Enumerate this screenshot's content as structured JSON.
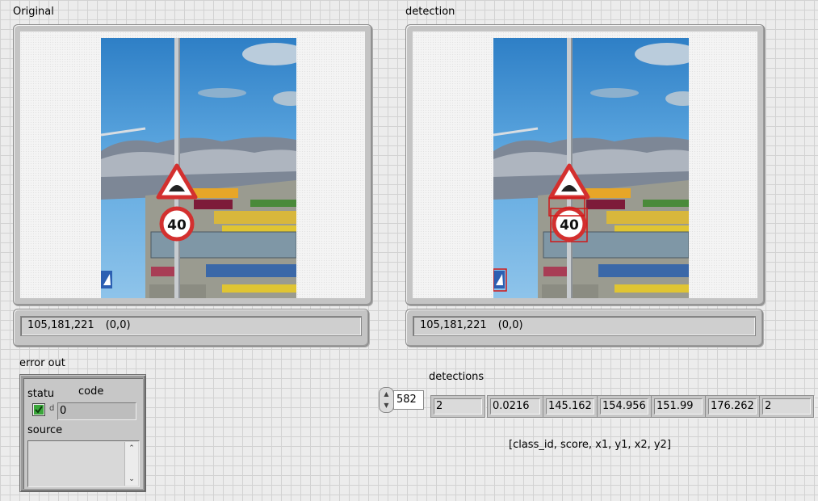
{
  "original": {
    "label": "Original",
    "pixel_info": "105,181,221",
    "coords": "(0,0)"
  },
  "detection": {
    "label": "detection",
    "pixel_info": "105,181,221",
    "coords": "(0,0)"
  },
  "sign_text": "40",
  "error_out": {
    "label": "error out",
    "status_label": "statu",
    "code_label": "code",
    "code_value": "0",
    "source_label": "source",
    "status_ok": true
  },
  "detections": {
    "label": "detections",
    "index": "582",
    "values": [
      "2",
      "0.0216",
      "145.162",
      "154.956",
      "151.99",
      "176.262",
      "2"
    ],
    "caption": "[class_id, score, x1, y1, x2, y2]"
  }
}
